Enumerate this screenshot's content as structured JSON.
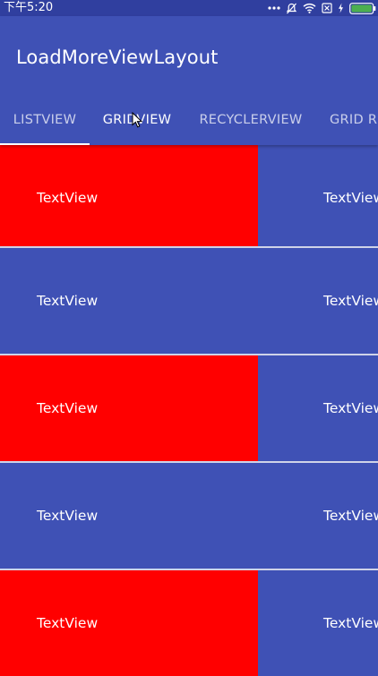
{
  "status_bar": {
    "time": "下午5:20",
    "icons": [
      "more-icon",
      "silent-icon",
      "wifi-icon",
      "sim-icon",
      "charging-icon",
      "battery-icon"
    ]
  },
  "app_bar": {
    "title": "LoadMoreViewLayout",
    "tabs": [
      {
        "label": "LISTVIEW",
        "selected": false
      },
      {
        "label": "GRIDVIEW",
        "selected": false
      },
      {
        "label": "RECYCLERVIEW",
        "selected": false
      },
      {
        "label": "GRID RE",
        "selected": false
      }
    ],
    "selected_tab_index": 0
  },
  "grid": {
    "rows": [
      {
        "left": {
          "text": "TextView",
          "color": "#ff0000"
        },
        "right": {
          "text": "TextView",
          "color": "#3f51b5"
        }
      },
      {
        "left": {
          "text": "TextView",
          "color": "#3f51b5"
        },
        "right": {
          "text": "TextView",
          "color": "#3f51b5"
        }
      },
      {
        "left": {
          "text": "TextView",
          "color": "#ff0000"
        },
        "right": {
          "text": "TextView",
          "color": "#3f51b5"
        }
      },
      {
        "left": {
          "text": "TextView",
          "color": "#3f51b5"
        },
        "right": {
          "text": "TextView",
          "color": "#3f51b5"
        }
      },
      {
        "left": {
          "text": "TextView",
          "color": "#ff0000"
        },
        "right": {
          "text": "TextView",
          "color": "#3f51b5"
        }
      }
    ]
  },
  "colors": {
    "primary": "#3f51b5",
    "primary_dark": "#303f9f",
    "highlight": "#ff0000",
    "battery": "#4caf50"
  }
}
